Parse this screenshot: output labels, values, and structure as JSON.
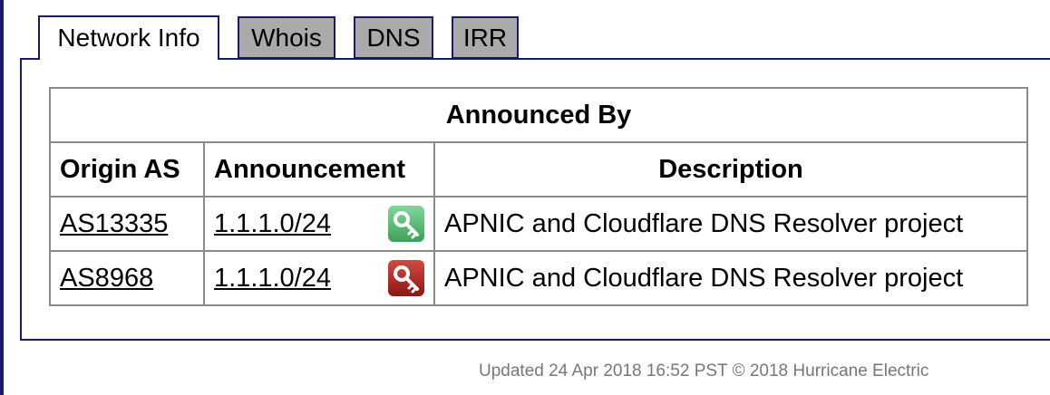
{
  "tabs": [
    {
      "label": "Network Info",
      "active": true
    },
    {
      "label": "Whois",
      "active": false
    },
    {
      "label": "DNS",
      "active": false
    },
    {
      "label": "IRR",
      "active": false
    }
  ],
  "table": {
    "title": "Announced By",
    "headers": {
      "origin": "Origin AS",
      "announcement": "Announcement",
      "description": "Description"
    },
    "rows": [
      {
        "origin": "AS13335",
        "announcement": "1.1.1.0/24",
        "rpki_icon": "key-icon-valid-green",
        "description": "APNIC and Cloudflare DNS Resolver project"
      },
      {
        "origin": "AS8968",
        "announcement": "1.1.1.0/24",
        "rpki_icon": "key-icon-invalid-red",
        "description": "APNIC and Cloudflare DNS Resolver project"
      }
    ]
  },
  "footer": "Updated 24 Apr 2018 16:52 PST © 2018 Hurricane Electric",
  "colors": {
    "border_navy": "#1a1a66",
    "inactive_tab": "#aaaaaa",
    "valid_key": "#4cba6a",
    "invalid_key": "#b3231d"
  }
}
